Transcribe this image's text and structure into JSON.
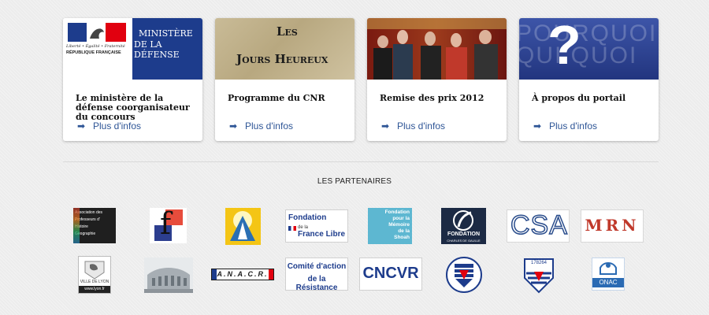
{
  "cards": [
    {
      "image": {
        "top_left": "Liberté • Égalité • Fraternité",
        "top_left_sub": "RÉPUBLIQUE FRANÇAISE",
        "right_line1": "MINISTÈRE",
        "right_line2": "DE LA DÉFENSE"
      },
      "title": "Le ministère de la défense coorganisateur du concours",
      "more": "Plus d'infos"
    },
    {
      "image": {
        "line1": "Les",
        "line2": "Jours Heureux"
      },
      "title": "Programme du CNR",
      "more": "Plus d'infos"
    },
    {
      "image": {},
      "title": "Remise des prix 2012",
      "more": "Plus d'infos"
    },
    {
      "image": {
        "mark": "?",
        "words": "POURQUOI QUI QUOI"
      },
      "title": "À propos du portail",
      "more": "Plus d'infos"
    }
  ],
  "partners_heading": "LES PARTENAIRES",
  "partners_row1": [
    {
      "name": "aphg",
      "lines": [
        "Association des",
        "Professeurs d'",
        "Histoire",
        "Géographie"
      ]
    },
    {
      "name": "f-logo",
      "text": "f"
    },
    {
      "name": "angel-logo"
    },
    {
      "name": "fondation-france-libre",
      "lines": [
        "Fondation",
        "de la",
        "France Libre"
      ]
    },
    {
      "name": "fondation-memoire-shoah",
      "lines": [
        "Fondation",
        "pour la",
        "Mémoire",
        "de la",
        "Shoah"
      ]
    },
    {
      "name": "fondation-charles-de-gaulle",
      "lines": [
        "FONDATION",
        "CHARLES DE GAULLE"
      ]
    },
    {
      "name": "csa",
      "text": "CSA"
    },
    {
      "name": "mrn",
      "text": "MRN"
    }
  ],
  "partners_row2": [
    {
      "name": "ville-de-lyon",
      "lines": [
        "VILLE DE LYON",
        "www.lyon.fr"
      ]
    },
    {
      "name": "building-photo"
    },
    {
      "name": "anacr",
      "text": "A.N.A.C.R."
    },
    {
      "name": "comite-action-resistance",
      "lines": [
        "Comité d'action",
        "de la Résistance"
      ]
    },
    {
      "name": "cncvr",
      "text": "CNCVR"
    },
    {
      "name": "shield-1"
    },
    {
      "name": "shield-2",
      "text": "178264"
    },
    {
      "name": "onac",
      "text": "ONAC"
    }
  ],
  "colors": {
    "link": "#2e5596",
    "defense_blue": "#1d3c8c",
    "shoah_teal": "#5db7d1",
    "onac_blue": "#2a6ab3"
  }
}
